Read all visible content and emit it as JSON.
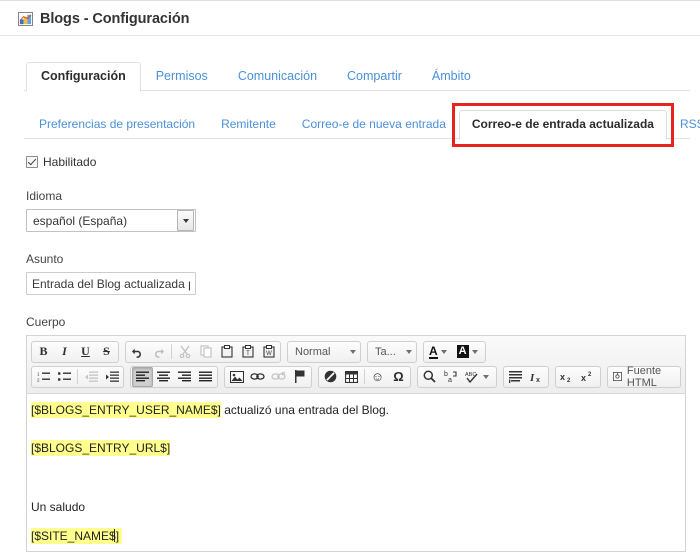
{
  "window": {
    "icon": "image-chart-icon",
    "title": "Blogs - Configuración"
  },
  "primary_tabs": [
    {
      "label": "Configuración",
      "active": true
    },
    {
      "label": "Permisos",
      "active": false
    },
    {
      "label": "Comunicación",
      "active": false
    },
    {
      "label": "Compartir",
      "active": false
    },
    {
      "label": "Ámbito",
      "active": false
    }
  ],
  "secondary_tabs": [
    {
      "label": "Preferencias de presentación",
      "active": false
    },
    {
      "label": "Remitente",
      "active": false
    },
    {
      "label": "Correo-e de nueva entrada",
      "active": false
    },
    {
      "label": "Correo-e de entrada actualizada",
      "active": true
    },
    {
      "label": "RSS",
      "active": false
    }
  ],
  "annotation": {
    "color": "#e8221c",
    "target": "Correo-e de entrada actualizada"
  },
  "form": {
    "enabled_checkbox": {
      "label": "Habilitado",
      "checked": true
    },
    "language": {
      "label": "Idioma",
      "value": "español (España)",
      "options": [
        "español (España)"
      ]
    },
    "subject": {
      "label": "Asunto",
      "value": "Entrada del Blog actualizada por",
      "placeholder": ""
    },
    "body": {
      "label": "Cuerpo"
    }
  },
  "editor": {
    "toolbar_row1": {
      "group_format": [
        {
          "name": "bold-icon",
          "glyph": "B"
        },
        {
          "name": "italic-icon",
          "glyph": "I"
        },
        {
          "name": "underline-icon",
          "glyph": "U"
        },
        {
          "name": "strikethrough-icon",
          "glyph": "S"
        }
      ],
      "group_history": [
        {
          "name": "undo-icon",
          "glyph": "↰"
        },
        {
          "name": "redo-icon",
          "glyph": "↱"
        }
      ],
      "group_clipboard": [
        {
          "name": "cut-icon",
          "glyph": "✂"
        },
        {
          "name": "copy-icon",
          "glyph": "❐"
        },
        {
          "name": "paste-icon",
          "glyph": "📋"
        },
        {
          "name": "paste-text-icon",
          "glyph": "📋"
        },
        {
          "name": "paste-word-icon",
          "glyph": "📋"
        }
      ],
      "combo_style": "Normal",
      "combo_font": "Ta...",
      "text_color_label": "A",
      "bg_color_label": "A"
    },
    "toolbar_row2": {
      "group_list": [
        {
          "name": "numbered-list-icon"
        },
        {
          "name": "bulleted-list-icon"
        },
        {
          "name": "decrease-indent-icon"
        },
        {
          "name": "increase-indent-icon"
        }
      ],
      "group_align": [
        {
          "name": "align-left-icon"
        },
        {
          "name": "align-center-icon"
        },
        {
          "name": "align-right-icon"
        },
        {
          "name": "align-justify-icon"
        }
      ],
      "group_insert": [
        {
          "name": "image-icon"
        },
        {
          "name": "link-icon"
        },
        {
          "name": "unlink-icon"
        },
        {
          "name": "anchor-flag-icon"
        }
      ],
      "group_media": [
        {
          "name": "page-break-icon"
        },
        {
          "name": "table-icon"
        },
        {
          "name": "smiley-icon",
          "glyph": "☺"
        },
        {
          "name": "special-character-icon",
          "glyph": "Ω"
        }
      ],
      "group_tools": [
        {
          "name": "search-icon"
        },
        {
          "name": "replace-icon"
        },
        {
          "name": "spellcheck-icon"
        }
      ],
      "group_clean": [
        {
          "name": "block-quote-icon"
        },
        {
          "name": "remove-format-icon"
        }
      ],
      "group_script": [
        {
          "name": "subscript-icon"
        },
        {
          "name": "superscript-icon"
        }
      ],
      "source_button": {
        "name": "html-source-button",
        "label": "Fuente HTML"
      }
    },
    "content": {
      "line1_token": "[$BLOGS_ENTRY_USER_NAME$]",
      "line1_rest": " actualizó una entrada del Blog.",
      "line2_token": "[$BLOGS_ENTRY_URL$]",
      "line3": "Un saludo",
      "line4_token": "[$SITE_NAME$]",
      "highlight_color": "#ffff8d"
    }
  }
}
